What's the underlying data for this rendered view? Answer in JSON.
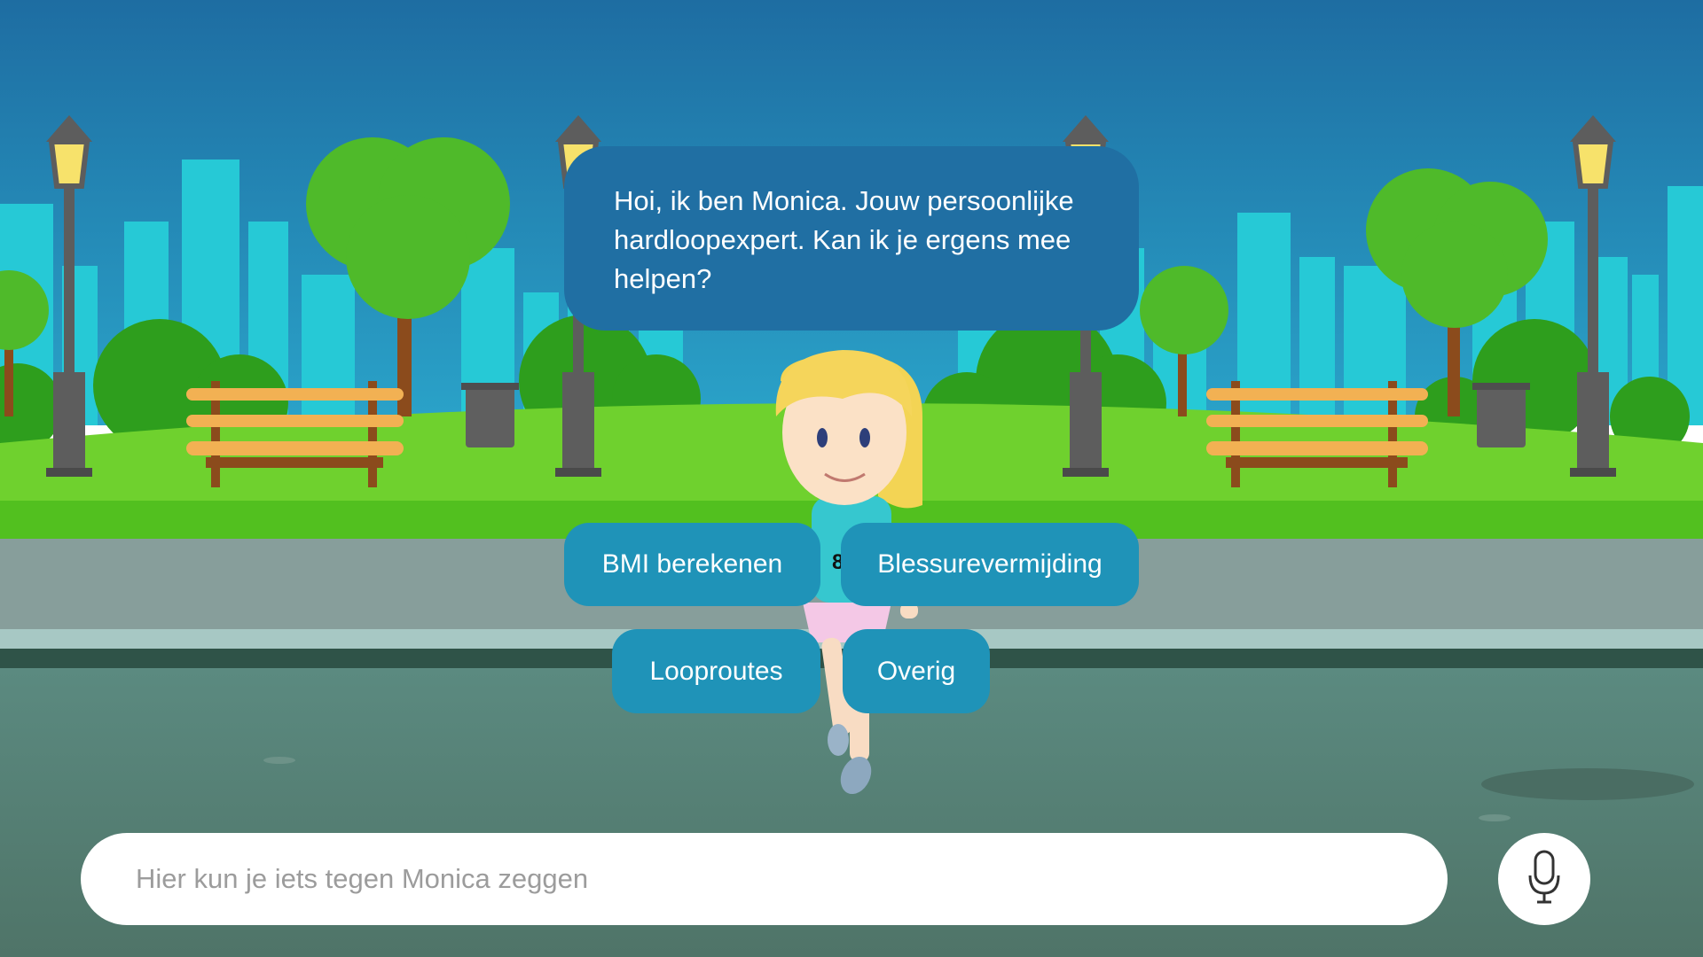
{
  "chat": {
    "message": "Hoi, ik ben Monica. Jouw persoonlijke hardloopexpert. Kan ik je ergens mee helpen?"
  },
  "options": {
    "bmi": "BMI berekenen",
    "blessure": "Blessurevermijding",
    "looproutes": "Looproutes",
    "overig": "Overig"
  },
  "runner": {
    "bib_number": "8"
  },
  "input": {
    "placeholder": "Hier kun je iets tegen Monica zeggen",
    "value": ""
  },
  "icons": {
    "send": "microphone-icon"
  },
  "colors": {
    "sky_top": "#1f6ea2",
    "bubble": "#206fa3",
    "button": "#1f93b8",
    "grass": "#6fd12e",
    "road": "#4f7a6f"
  }
}
